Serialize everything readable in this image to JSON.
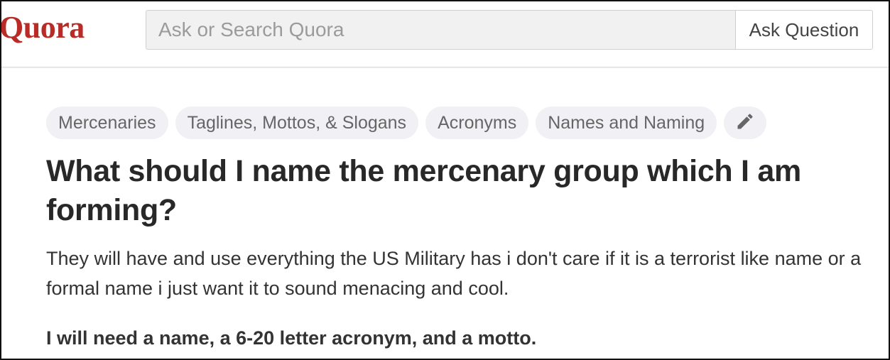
{
  "header": {
    "logo_text": "Quora",
    "search_placeholder": "Ask or Search Quora",
    "ask_button_label": "Ask Question"
  },
  "topics": [
    {
      "label": "Mercenaries"
    },
    {
      "label": "Taglines, Mottos, & Slogans"
    },
    {
      "label": "Acronyms"
    },
    {
      "label": "Names and Naming"
    }
  ],
  "edit_topics_icon": "pencil-icon",
  "question": {
    "title": "What should I name the mercenary group which I am forming?",
    "details": "They will have and use everything the US Military has i don't care if it is a terrorist like name or a formal name i just want it to sound menacing and cool.",
    "emphasis": "I will need a name, a 6-20 letter acronym, and a motto."
  },
  "colors": {
    "brand": "#b92b27",
    "text": "#282829",
    "topic_bg": "#f0f0f5"
  }
}
